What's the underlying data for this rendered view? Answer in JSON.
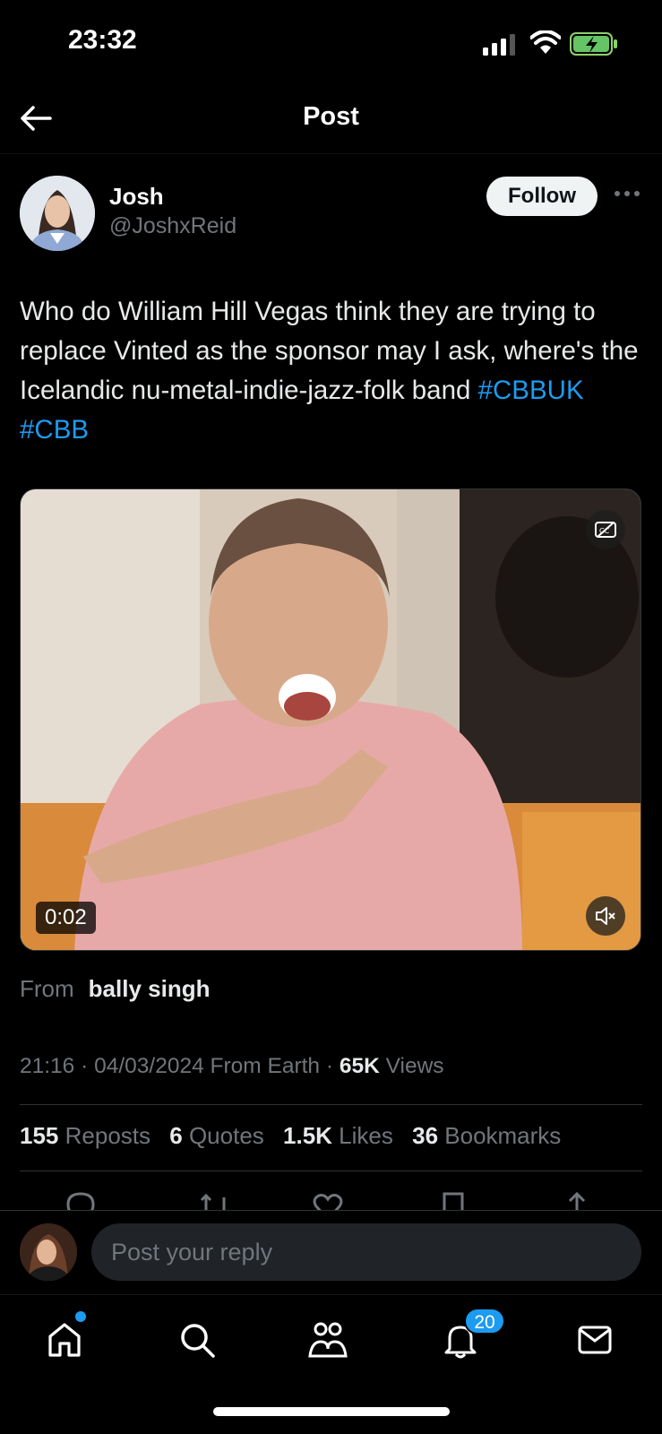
{
  "status_bar": {
    "time": "23:32"
  },
  "header": {
    "title": "Post"
  },
  "author": {
    "name": "Josh",
    "handle": "@JoshxReid",
    "follow_label": "Follow"
  },
  "post": {
    "text": "Who do William Hill Vegas think they are trying to replace Vinted as the sponsor may I ask, where's the Icelandic nu-metal-indie-jazz-folk band",
    "hashtags": [
      "#CBBUK",
      "#CBB"
    ]
  },
  "media": {
    "duration": "0:02"
  },
  "source": {
    "label": "From",
    "name": "bally singh"
  },
  "meta": {
    "time": "21:16",
    "date": "04/03/2024",
    "location": "From Earth",
    "views_count": "65K",
    "views_label": "Views"
  },
  "stats": [
    {
      "count": "155",
      "label": "Reposts"
    },
    {
      "count": "6",
      "label": "Quotes"
    },
    {
      "count": "1.5K",
      "label": "Likes"
    },
    {
      "count": "36",
      "label": "Bookmarks"
    }
  ],
  "reply": {
    "placeholder": "Post your reply"
  },
  "tab_bar": {
    "notifications_badge": "20"
  },
  "colors": {
    "accent": "#1d9bf0",
    "background": "#000000",
    "text": "#e7e9ea",
    "muted": "#71767b"
  }
}
